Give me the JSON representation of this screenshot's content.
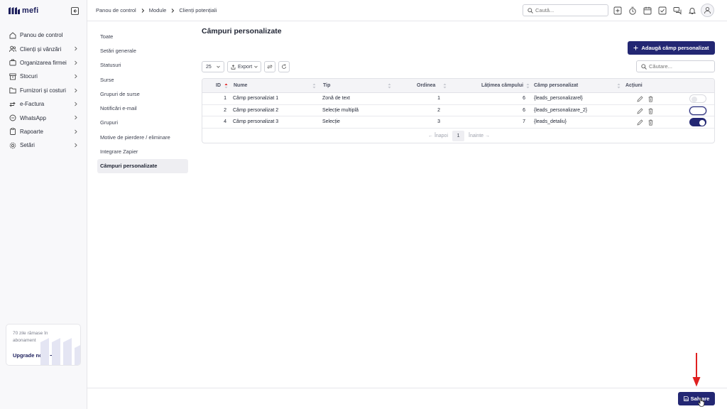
{
  "brand": {
    "name": "mefi",
    "color": "#1d1f5c"
  },
  "colors": {
    "accent": "#232773",
    "highlight": "#e02020"
  },
  "sidebar": {
    "items": [
      {
        "label": "Panou de control",
        "icon": "home-icon",
        "chevron": false
      },
      {
        "label": "Clienți și vânzări",
        "icon": "users-icon",
        "chevron": true
      },
      {
        "label": "Organizarea firmei",
        "icon": "org-icon",
        "chevron": true
      },
      {
        "label": "Stocuri",
        "icon": "box-icon",
        "chevron": true
      },
      {
        "label": "Furnizori și costuri",
        "icon": "folder-icon",
        "chevron": true
      },
      {
        "label": "e-Factura",
        "icon": "efactura-icon",
        "chevron": true
      },
      {
        "label": "WhatsApp",
        "icon": "chat-icon",
        "chevron": true
      },
      {
        "label": "Rapoarte",
        "icon": "clipboard-icon",
        "chevron": true
      },
      {
        "label": "Setări",
        "icon": "gear-icon",
        "chevron": true
      }
    ],
    "upgrade": {
      "text": "70 zile rămase în abonament",
      "link": "Upgrade now"
    }
  },
  "topbar": {
    "breadcrumb": [
      "Panou de control",
      "Module",
      "Clienți potențiali"
    ],
    "search_placeholder": "Caută..."
  },
  "settings_menu": {
    "items": [
      "Toate",
      "Setări generale",
      "Statusuri",
      "Surse",
      "Grupuri de surse",
      "Notificări e-mail",
      "Grupuri",
      "Motive de pierdere / eliminare",
      "Integrare Zapier",
      "Câmpuri personalizate"
    ],
    "active": "Câmpuri personalizate"
  },
  "main": {
    "title": "Câmpuri personalizate",
    "add_button": "Adaugă câmp personalizat",
    "page_size": "25",
    "export_label": "Export",
    "search_placeholder": "Căutare...",
    "columns": [
      "ID",
      "Nume",
      "Tip",
      "Ordinea",
      "Lățimea câmpului",
      "Câmp personalizat",
      "Acțiuni"
    ],
    "rows": [
      {
        "id": "1",
        "name": "Câmp personalziat 1",
        "type": "Zonă de text",
        "order": "1",
        "width": "6",
        "field": "{leads_personalizarel}",
        "active": false
      },
      {
        "id": "2",
        "name": "Câmp personalizat 2",
        "type": "Selecție multiplă",
        "order": "2",
        "width": "6",
        "field": "{leads_personalizare_2}",
        "active": false
      },
      {
        "id": "4",
        "name": "Câmp personalizat 3",
        "type": "Selecție",
        "order": "3",
        "width": "7",
        "field": "{leads_detaliu}",
        "active": true
      }
    ],
    "pager": {
      "prev": "Înapoi",
      "current": "1",
      "next": "Înainte"
    }
  },
  "footer": {
    "save_label": "Salvare"
  }
}
